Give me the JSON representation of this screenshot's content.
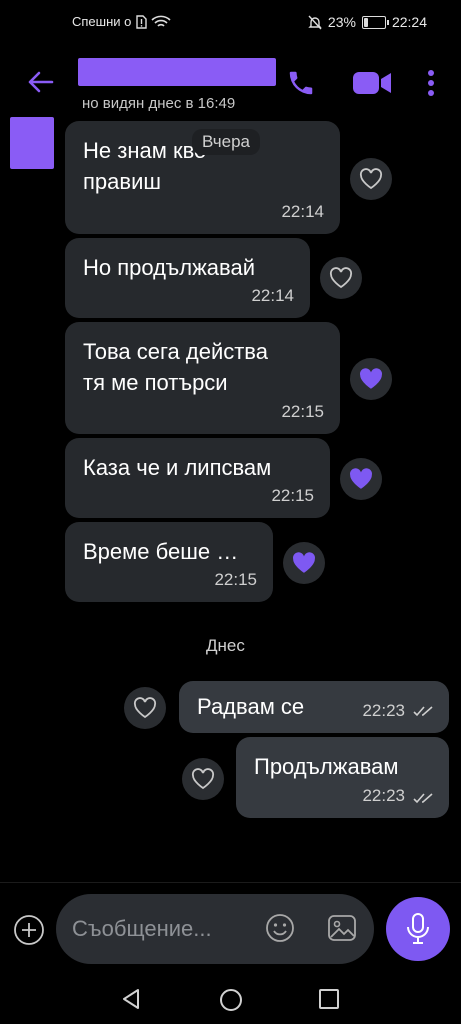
{
  "status_bar": {
    "carrier": "Спешни о",
    "battery": "23%",
    "battery_level": 0.23,
    "time": "22:24"
  },
  "header": {
    "last_seen": "но видян днес в 16:49",
    "icons": [
      "back-arrow-icon",
      "phone-icon",
      "video-camera-icon",
      "more-vertical-icon"
    ],
    "accent": "#8a5cf5"
  },
  "dates": {
    "yesterday": "Вчера",
    "today": "Днес"
  },
  "messages": [
    {
      "text": "Не знам кво\nправиш",
      "time": "22:14",
      "direction": "incoming",
      "liked": false
    },
    {
      "text": "Но продължавай",
      "time": "22:14",
      "direction": "incoming",
      "liked": false
    },
    {
      "text": "Това сега действа\nтя ме потърси",
      "time": "22:15",
      "direction": "incoming",
      "liked": true
    },
    {
      "text": "Каза че и липсвам",
      "time": "22:15",
      "direction": "incoming",
      "liked": true
    },
    {
      "text": "Време беше …",
      "time": "22:15",
      "direction": "incoming",
      "liked": true
    },
    {
      "text": "Радвам се",
      "time": "22:23",
      "direction": "outgoing",
      "liked": false
    },
    {
      "text": "Продължавам",
      "time": "22:23",
      "direction": "outgoing",
      "liked": false
    }
  ],
  "composer": {
    "placeholder": "Съобщение...",
    "icons": [
      "plus-icon",
      "smiley-icon",
      "gallery-icon",
      "mic-icon"
    ]
  },
  "colors": {
    "bubble_in": "#26292d",
    "bubble_out": "#363a40",
    "heart_active": "#7e59f2",
    "mic_button": "#7e59f2"
  }
}
